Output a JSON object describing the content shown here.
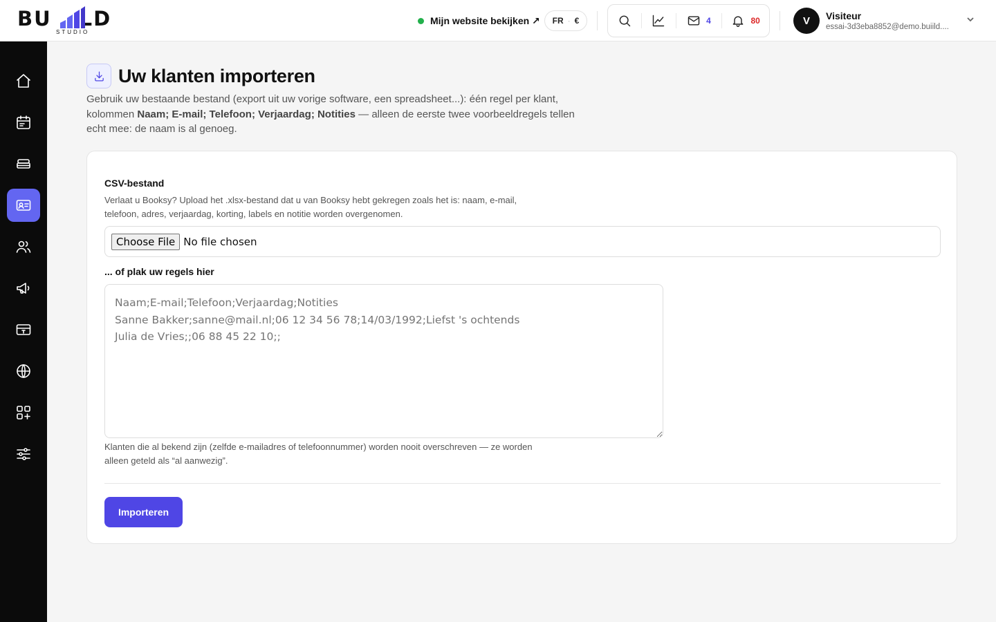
{
  "brand": {
    "logo_left": "BU",
    "logo_right": "LD",
    "logo_sub": "STUDIO"
  },
  "header": {
    "site_link": "Mijn website bekijken ↗",
    "lang": "FR",
    "currency": "€",
    "mail_count": "4",
    "notif_count": "80",
    "user": {
      "initial": "V",
      "name": "Visiteur",
      "email": "essai-3d3eba8852@demo.buiild...."
    }
  },
  "sidebar": {
    "items": [
      {
        "name": "home-icon"
      },
      {
        "name": "calendar-icon"
      },
      {
        "name": "services-icon"
      },
      {
        "name": "clients-card-icon",
        "active": true
      },
      {
        "name": "team-icon"
      },
      {
        "name": "megaphone-icon"
      },
      {
        "name": "payment-icon"
      },
      {
        "name": "globe-icon"
      },
      {
        "name": "apps-icon"
      },
      {
        "name": "settings-sliders-icon"
      }
    ]
  },
  "page": {
    "title": "Uw klanten importeren",
    "intro_a": "Gebruik uw bestaande bestand (export uit uw vorige software, een spreadsheet...): één regel per klant, kolommen ",
    "intro_bold": "Naam; E-mail; Telefoon; Verjaardag; Notities",
    "intro_b": " — alleen de eerste twee voorbeeldregels tellen echt mee: de naam is al genoeg."
  },
  "form": {
    "csv_label": "CSV-bestand",
    "csv_help": "Verlaat u Booksy? Upload het .xlsx-bestand dat u van Booksy hebt gekregen zoals het is: naam, e-mail, telefoon, adres, verjaardag, korting, labels en notitie worden overgenomen.",
    "file_button": "Choose File",
    "file_status": "No file chosen",
    "paste_label": "... of plak uw regels hier",
    "paste_placeholder": "Naam;E-mail;Telefoon;Verjaardag;Notities\nSanne Bakker;sanne@mail.nl;06 12 34 56 78;14/03/1992;Liefst 's ochtends\nJulia de Vries;;06 88 45 22 10;;",
    "paste_help": "Klanten die al bekend zijn (zelfde e-mailadres of telefoonnummer) worden nooit overschreven — ze worden alleen geteld als “al aanwezig”.",
    "submit": "Importeren"
  }
}
